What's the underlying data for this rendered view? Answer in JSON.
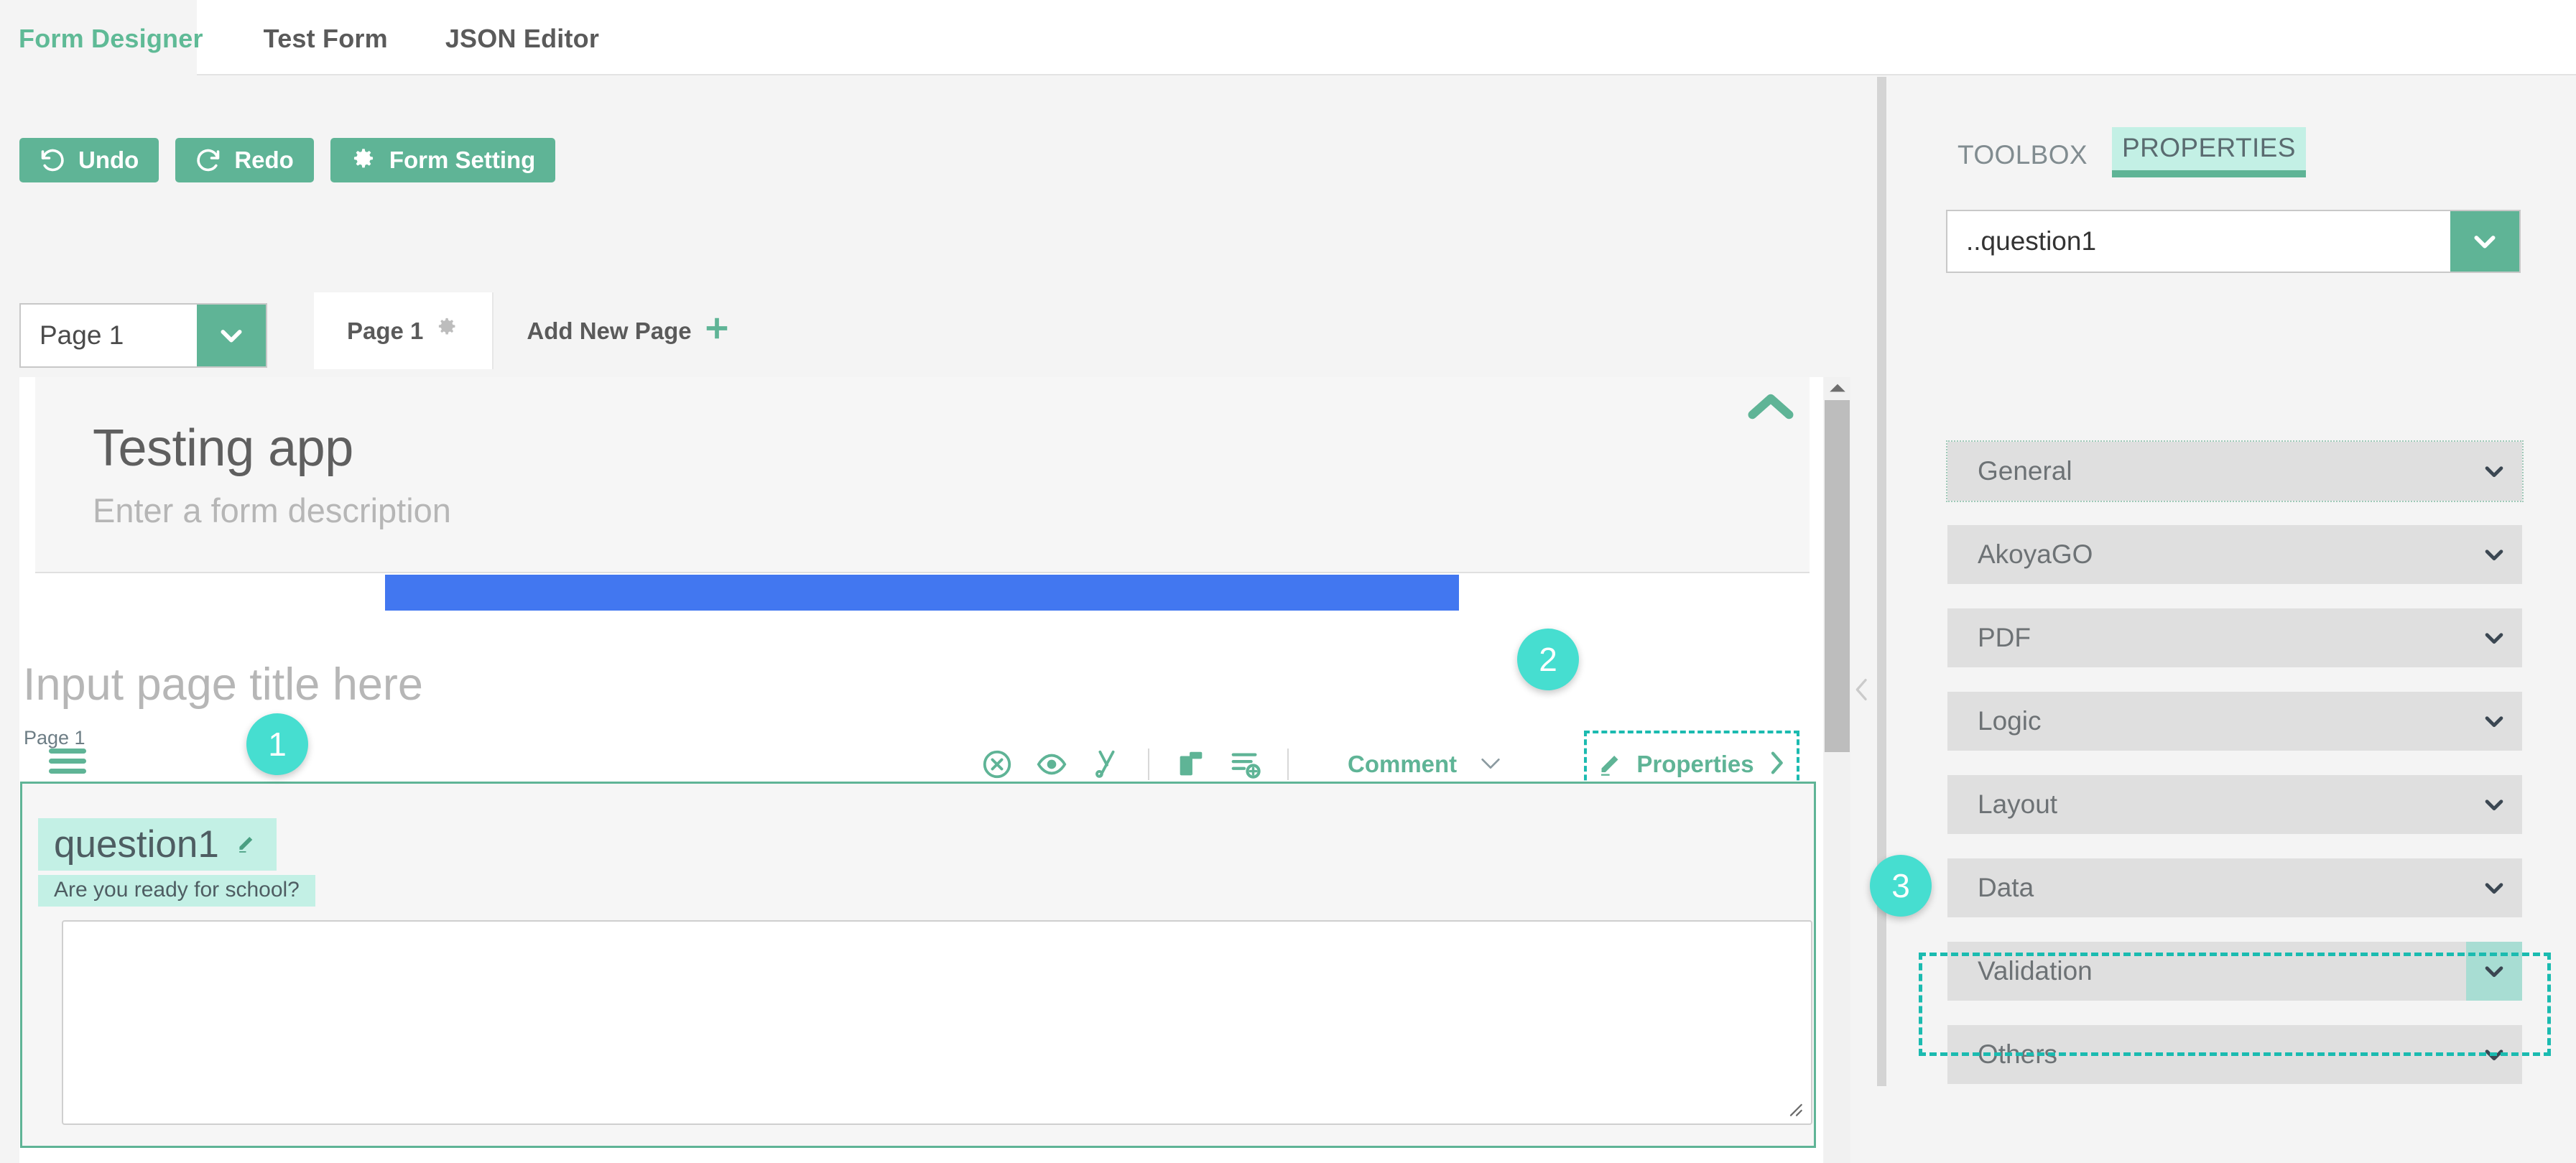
{
  "nav": {
    "tabs": [
      {
        "label": "Form Designer",
        "active": true
      },
      {
        "label": "Test Form",
        "active": false
      },
      {
        "label": "JSON Editor",
        "active": false
      }
    ]
  },
  "toolbar": {
    "undo_label": "Undo",
    "redo_label": "Redo",
    "form_setting_label": "Form Setting"
  },
  "page_select": {
    "value": "Page 1"
  },
  "page_tabs": {
    "active_tab": "Page 1",
    "add_label": "Add New Page"
  },
  "canvas": {
    "form_title": "Testing app",
    "form_description": "Enter a form description",
    "page_title_placeholder": "Input page title here",
    "page_mini_label": "Page 1"
  },
  "element_toolbar": {
    "icons": [
      "delete-circle-icon",
      "visibility-eye-icon",
      "cut-scissors-icon",
      "copy-icon",
      "add-list-item-icon"
    ],
    "comment_label": "Comment",
    "properties_label": "Properties"
  },
  "question": {
    "name": "question1",
    "subtitle": "Are you ready for school?",
    "answer_value": ""
  },
  "badges": {
    "one": "1",
    "two": "2",
    "three": "3"
  },
  "properties_panel": {
    "tabs": [
      {
        "label": "TOOLBOX",
        "active": false
      },
      {
        "label": "PROPERTIES",
        "active": true
      }
    ],
    "element_select_value": "..question1",
    "accordion": [
      {
        "label": "General",
        "state": "dotted"
      },
      {
        "label": "AkoyaGO",
        "state": "normal"
      },
      {
        "label": "PDF",
        "state": "normal"
      },
      {
        "label": "Logic",
        "state": "normal"
      },
      {
        "label": "Layout",
        "state": "normal"
      },
      {
        "label": "Data",
        "state": "normal"
      },
      {
        "label": "Validation",
        "state": "highlighted"
      },
      {
        "label": "Others",
        "state": "normal"
      }
    ]
  },
  "colors": {
    "green": "#5fb496",
    "teal_badge": "#46ded0",
    "teal_highlight": "#c3f0e5",
    "dashed_teal": "#1bbbb0",
    "blue_bar": "#4277f0",
    "accordion_bg": "#dfdfdf"
  }
}
